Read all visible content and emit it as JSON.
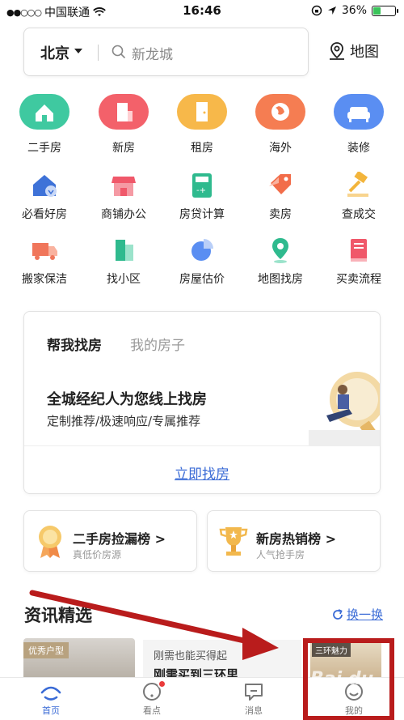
{
  "status_bar": {
    "signal": "●●○○○",
    "carrier": "中国联通",
    "time": "16:46",
    "battery": "36%",
    "battery_level": 0.36
  },
  "search": {
    "city": "北京",
    "placeholder": "新龙城",
    "map_label": "地图"
  },
  "main_icons": [
    {
      "label": "二手房",
      "color": "#3fc9a0"
    },
    {
      "label": "新房",
      "color": "#f3616a"
    },
    {
      "label": "租房",
      "color": "#f7b84a"
    },
    {
      "label": "海外",
      "color": "#f57d52"
    },
    {
      "label": "装修",
      "color": "#5a8ef2"
    }
  ],
  "secondary_icons": [
    {
      "label": "必看好房",
      "icon": "house-heart-icon"
    },
    {
      "label": "商铺办公",
      "icon": "shop-icon"
    },
    {
      "label": "房贷计算",
      "icon": "calculator-icon"
    },
    {
      "label": "卖房",
      "icon": "price-tag-icon"
    },
    {
      "label": "查成交",
      "icon": "gavel-icon"
    },
    {
      "label": "搬家保洁",
      "icon": "truck-icon"
    },
    {
      "label": "找小区",
      "icon": "building-icon"
    },
    {
      "label": "房屋估价",
      "icon": "pie-chart-icon"
    },
    {
      "label": "地图找房",
      "icon": "map-pin-icon"
    },
    {
      "label": "买卖流程",
      "icon": "book-icon"
    }
  ],
  "finder_card": {
    "tabs": [
      "帮我找房",
      "我的房子"
    ],
    "headline": "全城经纪人为您线上找房",
    "subline": "定制推荐/极速响应/专属推荐",
    "action": "立即找房"
  },
  "rankings": [
    {
      "title": "二手房捡漏榜",
      "chevron": ">",
      "sub": "真低价房源"
    },
    {
      "title": "新房热销榜",
      "chevron": ">",
      "sub": "人气抢手房"
    }
  ],
  "news": {
    "title": "资讯精选",
    "refresh": "换一换",
    "item1_tag": "优秀户型",
    "item2_line1": "刚需也能买得起",
    "item2_line2": "刚需买到三环里",
    "item3_tag": "三环魅力"
  },
  "tabbar": [
    {
      "label": "首页",
      "active": true
    },
    {
      "label": "看点",
      "active": false
    },
    {
      "label": "消息",
      "active": false
    },
    {
      "label": "我的",
      "active": false
    }
  ],
  "watermark": "Bai du",
  "colors": {
    "accent": "#3a6bd6",
    "annotation_red": "#b91c1c"
  }
}
